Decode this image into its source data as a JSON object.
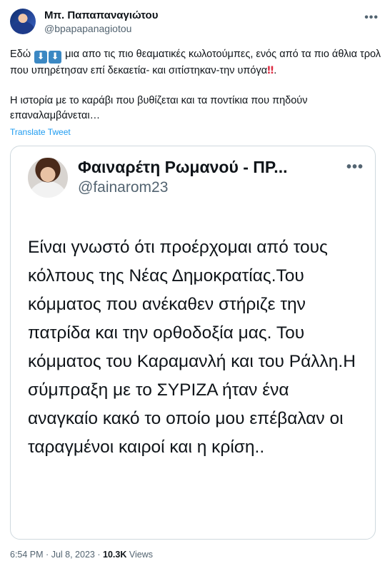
{
  "author": {
    "name": "Μπ. Παπαπαναγιώτου",
    "handle": "@bpapapanagiotou"
  },
  "tweet": {
    "line1_prefix": "Εδώ",
    "arrow_emoji": "⬇",
    "line1_rest": "μια απο τις πιο θεαματικές κωλοτούμπες, ενός από τα πιο άθλια τρολ που υπηρέτησαν επί δεκαετία- και σιτίστηκαν-την υπόγα",
    "bang_emoji": "‼",
    "line1_end": ".",
    "paragraph2": "Η ιστορία με το καράβι που βυθίζεται και τα ποντίκια που πηδούν επαναλαμβάνεται…",
    "translate_label": "Translate Tweet"
  },
  "quoted": {
    "name": "Φαιναρέτη Ρωμανού - ΠΡ...",
    "handle": "@fainarom23",
    "text": "Είναι γνωστό ότι προέρχομαι από τους κόλπους της Νέας Δημοκρατίας.Του κόμματος που ανέκαθεν στήριζε την πατρίδα και την ορθοδοξία μας. Του κόμματος του Καραμανλή και του Ράλλη.Η σύμπραξη με το ΣΥΡΙΖΑ ήταν ένα αναγκαίο κακό το οποίο μου επέβαλαν οι ταραγμένοι καιροί και η κρίση.."
  },
  "meta": {
    "time": "6:54 PM",
    "separator": "·",
    "date": "Jul 8, 2023",
    "views_count": "10.3K",
    "views_label": "Views"
  },
  "icons": {
    "more": "more-icon"
  },
  "more_glyph": "•••"
}
